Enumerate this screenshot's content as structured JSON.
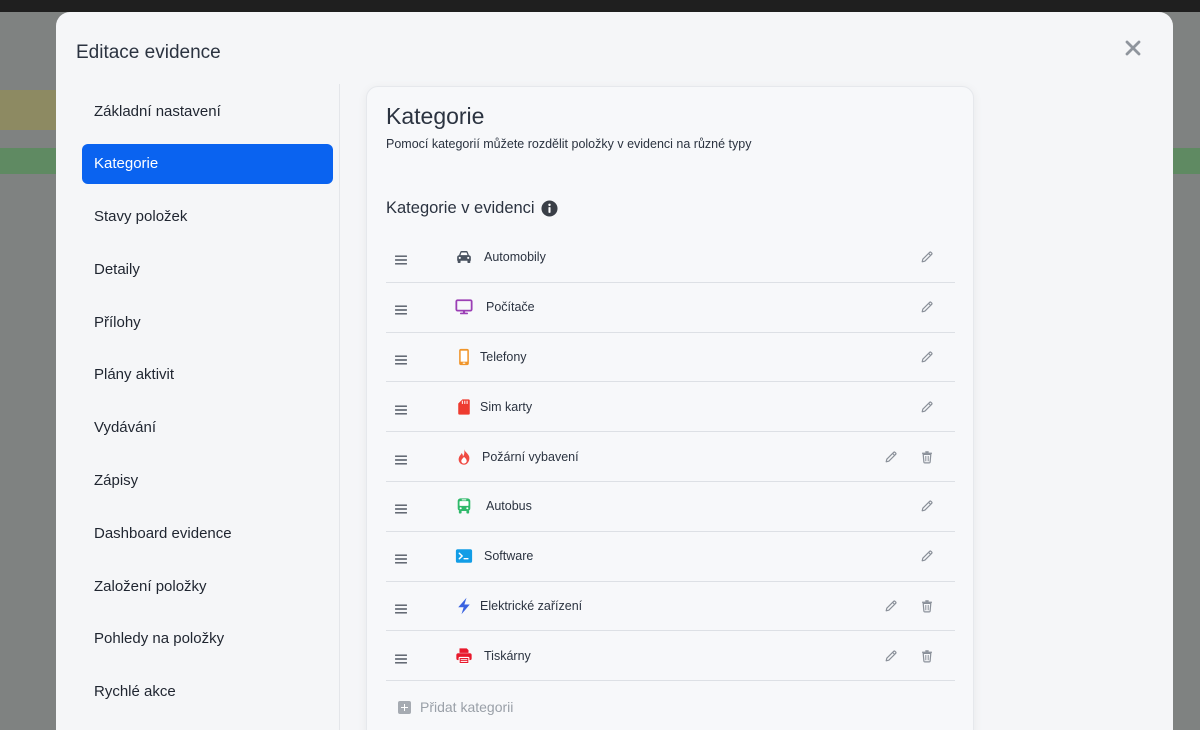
{
  "modal": {
    "title": "Editace evidence"
  },
  "sidebar": {
    "items": [
      {
        "label": "Základní nastavení",
        "active": false
      },
      {
        "label": "Kategorie",
        "active": true
      },
      {
        "label": "Stavy položek",
        "active": false
      },
      {
        "label": "Detaily",
        "active": false
      },
      {
        "label": "Přílohy",
        "active": false
      },
      {
        "label": "Plány aktivit",
        "active": false
      },
      {
        "label": "Vydávání",
        "active": false
      },
      {
        "label": "Zápisy",
        "active": false
      },
      {
        "label": "Dashboard evidence",
        "active": false
      },
      {
        "label": "Založení položky",
        "active": false
      },
      {
        "label": "Pohledy na položky",
        "active": false
      },
      {
        "label": "Rychlé akce",
        "active": false
      }
    ]
  },
  "main": {
    "title": "Kategorie",
    "description": "Pomocí kategorií můžete rozdělit položky v evidenci na různé typy",
    "section_title": "Kategorie v evidenci",
    "add_label": "Přidat kategorii",
    "categories": [
      {
        "label": "Automobily",
        "icon": "car-icon",
        "color": "#4a5360",
        "deletable": false
      },
      {
        "label": "Počítače",
        "icon": "monitor-icon",
        "color": "#9b3fb5",
        "deletable": false
      },
      {
        "label": "Telefony",
        "icon": "phone-icon",
        "color": "#f0952a",
        "deletable": false
      },
      {
        "label": "Sim karty",
        "icon": "sim-card-icon",
        "color": "#ee3b2f",
        "deletable": false
      },
      {
        "label": "Požární vybavení",
        "icon": "fire-icon",
        "color": "#ef4a43",
        "deletable": true
      },
      {
        "label": "Autobus",
        "icon": "bus-icon",
        "color": "#2fb96a",
        "deletable": false
      },
      {
        "label": "Software",
        "icon": "terminal-icon",
        "color": "#129de6",
        "deletable": false
      },
      {
        "label": "Elektrické zařízení",
        "icon": "bolt-icon",
        "color": "#3a63e0",
        "deletable": true
      },
      {
        "label": "Tiskárny",
        "icon": "printer-icon",
        "color": "#e8192c",
        "deletable": true
      }
    ]
  },
  "colors": {
    "accent": "#0a63f0",
    "backdrop": "#7f8281",
    "modal_bg": "#f5f6f8"
  }
}
